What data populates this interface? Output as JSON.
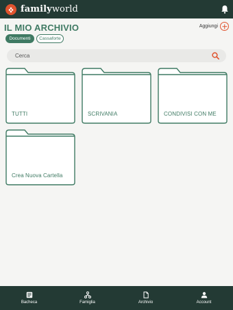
{
  "header": {
    "brand_bold": "family",
    "brand_light": "world"
  },
  "page": {
    "title": "IL MIO ARCHIVIO",
    "add_label": "Aggiungi"
  },
  "tabs": [
    {
      "label": "Documenti",
      "active": true
    },
    {
      "label": "Cassaforte",
      "active": false
    }
  ],
  "search": {
    "placeholder": "Cerca"
  },
  "folders": [
    {
      "label": "TUTTI"
    },
    {
      "label": "SCRIVANIA"
    },
    {
      "label": "CONDIVISI CON ME"
    },
    {
      "label": "Crea Nuova Cartella"
    }
  ],
  "nav": [
    {
      "label": "Bacheca",
      "icon": "board-icon"
    },
    {
      "label": "Famiglia",
      "icon": "family-icon"
    },
    {
      "label": "Archivio",
      "icon": "document-icon"
    },
    {
      "label": "Account",
      "icon": "account-icon"
    }
  ],
  "colors": {
    "brand_green": "#3f7a63",
    "dark_bar": "#233a34",
    "accent_orange": "#e0532e"
  }
}
